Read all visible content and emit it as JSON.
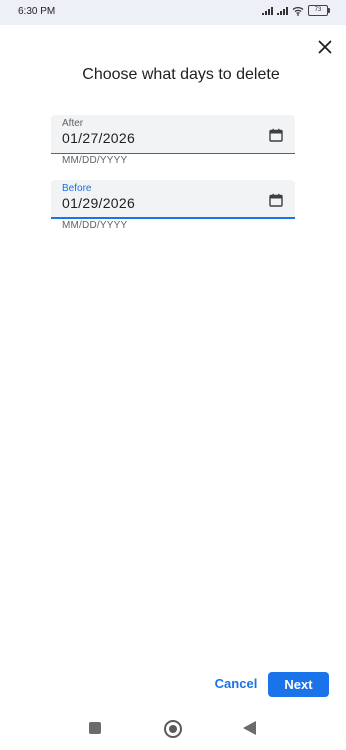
{
  "status_bar": {
    "time": "6:30 PM",
    "battery": "73",
    "icons": [
      "signal-icon",
      "signal-icon",
      "wifi-icon",
      "battery-icon"
    ]
  },
  "dialog": {
    "title": "Choose what days to delete",
    "close_icon": "close-icon"
  },
  "fields": {
    "after": {
      "label": "After",
      "value": "01/27/2026",
      "helper": "MM/DD/YYYY",
      "icon": "calendar-icon"
    },
    "before": {
      "label": "Before",
      "value": "01/29/2026",
      "helper": "MM/DD/YYYY",
      "icon": "calendar-icon",
      "focused": true
    }
  },
  "actions": {
    "cancel_label": "Cancel",
    "next_label": "Next"
  },
  "nav_bar": {
    "buttons": [
      "recents-icon",
      "home-icon",
      "back-icon"
    ]
  },
  "colors": {
    "accent": "#1a73e8",
    "field_bg": "#f1f3f4",
    "status_bg": "#eef0f8"
  }
}
